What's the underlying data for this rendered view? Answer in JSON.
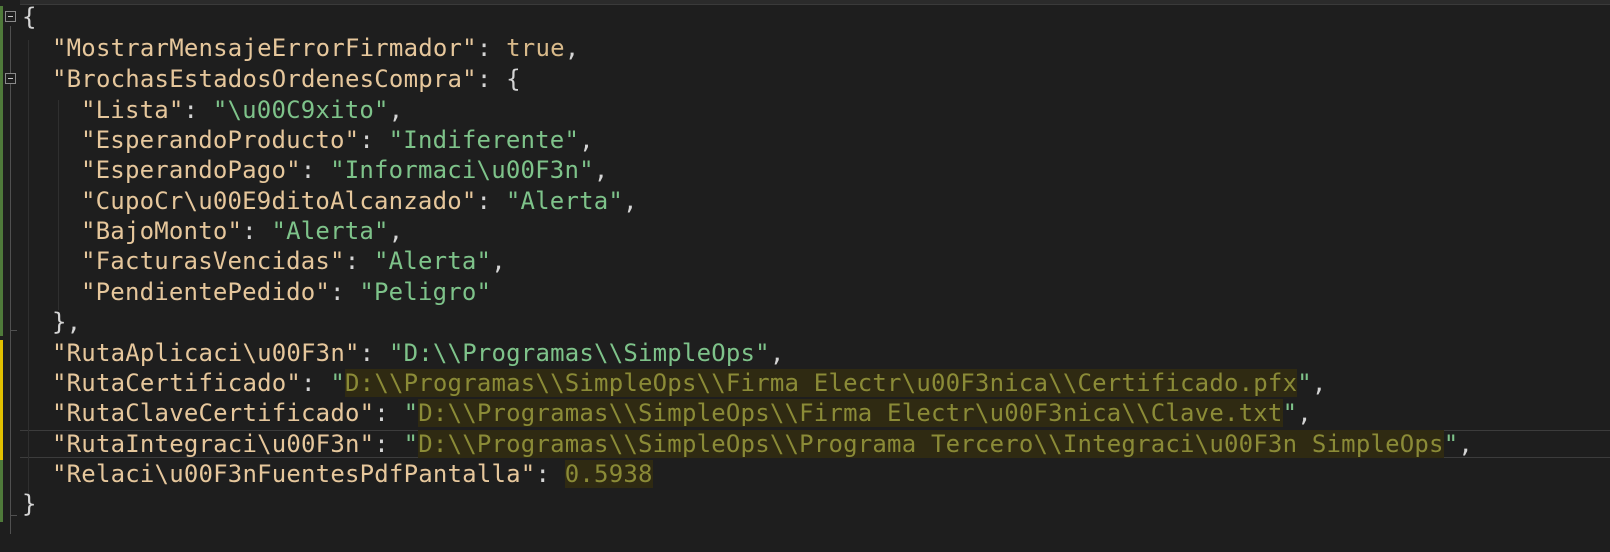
{
  "editor": {
    "lines": [
      {
        "open": "{"
      },
      {
        "key": "\"MostrarMensajeErrorFirmador\"",
        "sep": ": ",
        "value": "true",
        "tail": ","
      },
      {
        "key": "\"BrochasEstadosOrdenesCompra\"",
        "sep": ": ",
        "value": "{"
      },
      {
        "key": "\"Lista\"",
        "sep": ": ",
        "value": "\"\\u00C9xito\"",
        "tail": ","
      },
      {
        "key": "\"EsperandoProducto\"",
        "sep": ": ",
        "value": "\"Indiferente\"",
        "tail": ","
      },
      {
        "key": "\"EsperandoPago\"",
        "sep": ": ",
        "value": "\"Informaci\\u00F3n\"",
        "tail": ","
      },
      {
        "key": "\"CupoCr\\u00E9ditoAlcanzado\"",
        "sep": ": ",
        "value": "\"Alerta\"",
        "tail": ","
      },
      {
        "key": "\"BajoMonto\"",
        "sep": ": ",
        "value": "\"Alerta\"",
        "tail": ","
      },
      {
        "key": "\"FacturasVencidas\"",
        "sep": ": ",
        "value": "\"Alerta\"",
        "tail": ","
      },
      {
        "key": "\"PendientePedido\"",
        "sep": ": ",
        "value": "\"Peligro\""
      },
      {
        "close": "},"
      },
      {
        "key": "\"RutaAplicaci\\u00F3n\"",
        "sep": ": ",
        "value": "\"D:\\\\Programas\\\\SimpleOps\"",
        "tail": ","
      },
      {
        "key": "\"RutaCertificado\"",
        "sep": ": ",
        "q": "\"",
        "path": "D:\\\\Programas\\\\SimpleOps\\\\Firma Electr\\u00F3nica\\\\Certificado.pfx",
        "q2": "\"",
        "tail": ","
      },
      {
        "key": "\"RutaClaveCertificado\"",
        "sep": ": ",
        "q": "\"",
        "path": "D:\\\\Programas\\\\SimpleOps\\\\Firma Electr\\u00F3nica\\\\Clave.txt",
        "q2": "\"",
        "tail": ","
      },
      {
        "key": "\"RutaIntegraci\\u00F3n\"",
        "sep": ": ",
        "q": "\"",
        "path": "D:\\\\Programas\\\\SimpleOps\\\\Programa Tercero\\\\Integraci\\u00F3n SimpleOps",
        "q2": "\"",
        "tail": ","
      },
      {
        "key": "\"Relaci\\u00F3nFuentesPdfPantalla\"",
        "sep": ": ",
        "num": "0.5938"
      },
      {
        "close": "}"
      }
    ]
  }
}
